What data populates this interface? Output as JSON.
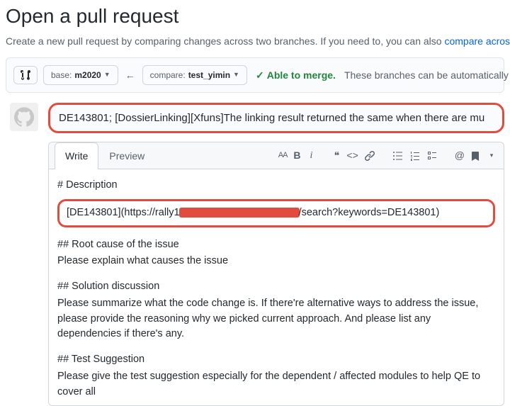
{
  "header": {
    "title": "Open a pull request",
    "subtitle_pre": "Create a new pull request by comparing changes across two branches. If you need to, you can also ",
    "compare_link": "compare across forks"
  },
  "range": {
    "base_label": "base:",
    "base_value": "m2020",
    "compare_label": "compare:",
    "compare_value": "test_yimin",
    "merge_status": "Able to merge.",
    "merge_note": "These branches can be automatically merged."
  },
  "form": {
    "title_value": "DE143801; [DossierLinking][Xfuns]The linking result returned the same when there are mu"
  },
  "tabs": {
    "write": "Write",
    "preview": "Preview"
  },
  "body": {
    "h_desc": "# Description",
    "desc_link_pre": "[DE143801](https://rally1",
    "desc_link_post": "/search?keywords=DE143801)",
    "h_root": "## Root cause of the issue",
    "root_text": "Please explain what causes the issue",
    "h_sol": "## Solution discussion",
    "sol_text": "Please summarize what the code change is. If there're alternative ways to address the issue, please provide the reasoning why we picked current approach. And please list any dependencies if there's any.",
    "h_test": "## Test Suggestion",
    "test_text": "Please give the test suggestion especially for the dependent / affected modules to help QE to cover all"
  }
}
